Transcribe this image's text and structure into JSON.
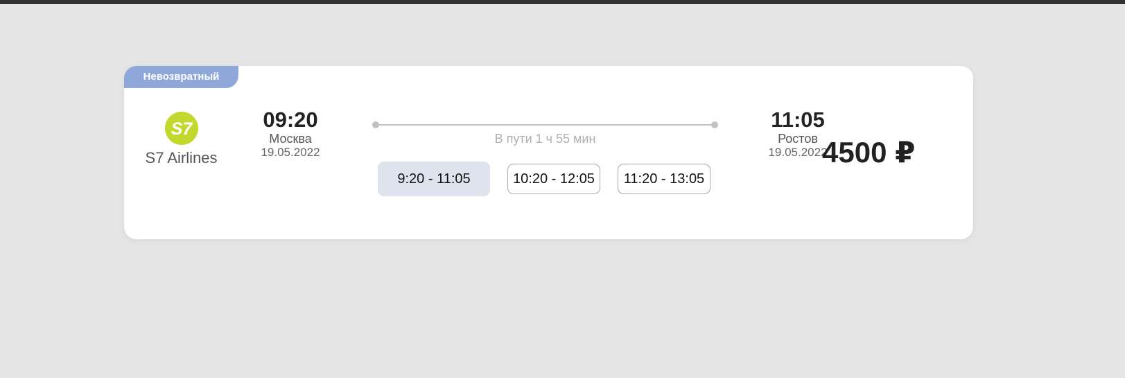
{
  "card": {
    "badge": "Невозвратный",
    "airline": {
      "name": "S7 Airlines",
      "logo_icon": "s7-logo-icon",
      "logo_color": "#c3d82c"
    },
    "departure": {
      "time": "09:20",
      "city": "Москва",
      "date": "19.05.2022"
    },
    "arrival": {
      "time": "11:05",
      "city": "Ростов",
      "date": "19.05.2022"
    },
    "duration": "В пути 1 ч 55 мин",
    "time_slots": [
      {
        "label": "9:20 - 11:05",
        "selected": true
      },
      {
        "label": "10:20 - 12:05",
        "selected": false
      },
      {
        "label": "11:20 - 13:05",
        "selected": false
      }
    ],
    "price": "4500 ₽"
  },
  "colors": {
    "badge_bg": "#8fa8d9",
    "selected_slot_bg": "#dfe3ee",
    "page_bg": "#e5e5e5"
  }
}
